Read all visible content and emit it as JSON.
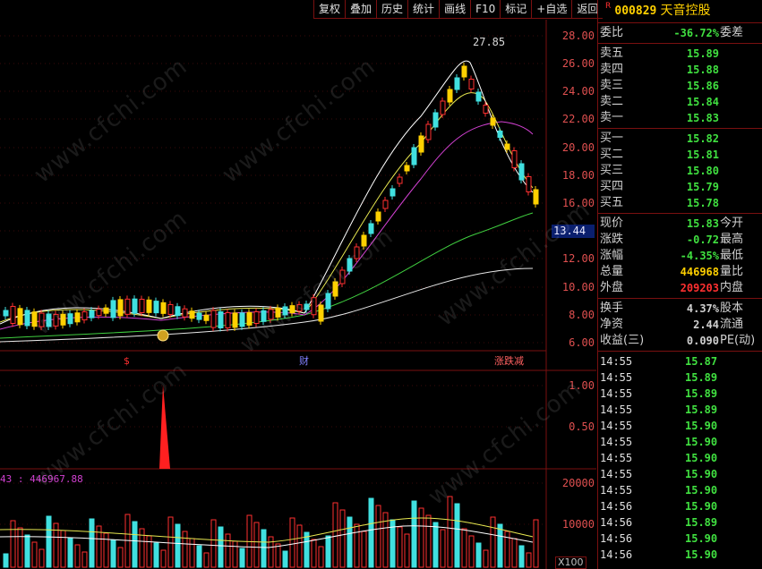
{
  "toolbar": {
    "items": [
      "复权",
      "叠加",
      "历史",
      "统计",
      "画线",
      "F10",
      "标记",
      "+自选",
      "返回"
    ]
  },
  "main_chart": {
    "y_ticks": [
      "28.00",
      "26.00",
      "24.00",
      "22.00",
      "20.00",
      "18.00",
      "16.00",
      "14.00",
      "12.00",
      "10.00",
      "8.00",
      "6.00"
    ],
    "current_price_label": "13.44",
    "max_label": "27.85",
    "events": [
      "$",
      "财",
      "涨跌减"
    ]
  },
  "indicator": {
    "y_ticks": [
      "1.00",
      "0.50"
    ]
  },
  "volume": {
    "readout": "43 : 446967.88",
    "y_ticks": [
      "20000",
      "10000"
    ],
    "scale_label": "X100"
  },
  "stock": {
    "r_mark": "R",
    "code": "000829",
    "name": "天音控股"
  },
  "quote": {
    "weibi": {
      "label": "委比",
      "value": "-36.72%",
      "right": "委差"
    },
    "sell": [
      {
        "label": "卖五",
        "price": "15.89"
      },
      {
        "label": "卖四",
        "price": "15.88"
      },
      {
        "label": "卖三",
        "price": "15.86"
      },
      {
        "label": "卖二",
        "price": "15.84"
      },
      {
        "label": "卖一",
        "price": "15.83"
      }
    ],
    "buy": [
      {
        "label": "买一",
        "price": "15.82"
      },
      {
        "label": "买二",
        "price": "15.81"
      },
      {
        "label": "买三",
        "price": "15.80"
      },
      {
        "label": "买四",
        "price": "15.79"
      },
      {
        "label": "买五",
        "price": "15.78"
      }
    ],
    "stats1": [
      {
        "label": "现价",
        "value": "15.83",
        "color": "#40e040",
        "right": "今开"
      },
      {
        "label": "涨跌",
        "value": "-0.72",
        "color": "#40e040",
        "right": "最高"
      },
      {
        "label": "涨幅",
        "value": "-4.35%",
        "color": "#40e040",
        "right": "最低"
      },
      {
        "label": "总量",
        "value": "446968",
        "color": "#ffd000",
        "right": "量比"
      },
      {
        "label": "外盘",
        "value": "209203",
        "color": "#ff3030",
        "right": "内盘"
      }
    ],
    "stats2": [
      {
        "label": "换手",
        "value": "4.37%",
        "color": "#d0d0d0",
        "right": "股本"
      },
      {
        "label": "净资",
        "value": "2.44",
        "color": "#d0d0d0",
        "right": "流通"
      },
      {
        "label": "收益(三)",
        "value": "0.090",
        "color": "#d0d0d0",
        "right": "PE(动)"
      }
    ]
  },
  "ticks": [
    {
      "time": "14:55",
      "price": "15.87"
    },
    {
      "time": "14:55",
      "price": "15.89"
    },
    {
      "time": "14:55",
      "price": "15.89"
    },
    {
      "time": "14:55",
      "price": "15.89"
    },
    {
      "time": "14:55",
      "price": "15.90"
    },
    {
      "time": "14:55",
      "price": "15.90"
    },
    {
      "time": "14:55",
      "price": "15.90"
    },
    {
      "time": "14:55",
      "price": "15.90"
    },
    {
      "time": "14:55",
      "price": "15.90"
    },
    {
      "time": "14:56",
      "price": "15.90"
    },
    {
      "time": "14:56",
      "price": "15.89"
    },
    {
      "time": "14:56",
      "price": "15.90"
    },
    {
      "time": "14:56",
      "price": "15.90"
    }
  ],
  "watermark": "www.cfchi.com",
  "colors": {
    "up": "#ff3030",
    "down": "#40e040",
    "frame": "#7a1010",
    "highlight": "#ffd000"
  }
}
